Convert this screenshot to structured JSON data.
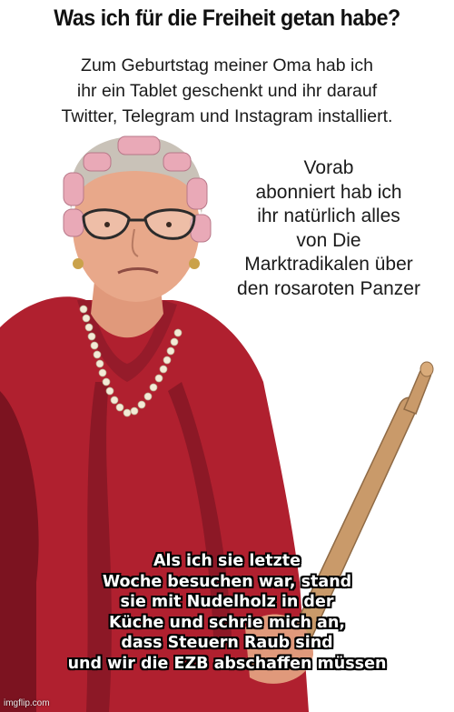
{
  "meme": {
    "title": "Was ich für die Freiheit getan habe?",
    "intro_lines": [
      "Zum Geburtstag meiner Oma hab ich",
      "ihr ein Tablet geschenkt und ihr darauf",
      "Twitter, Telegram und Instagram installiert."
    ],
    "side_lines": [
      "Vorab",
      "abonniert hab ich",
      "ihr natürlich alles",
      "von Die",
      "Marktradikalen über",
      "den rosaroten Panzer"
    ],
    "caption_lines": [
      "Als ich sie letzte",
      "Woche besuchen war, stand",
      "sie mit Nudelholz in der",
      "Küche und schrie mich an,",
      "dass Steuern Raub sind",
      "und wir die EZB abschaffen müssen"
    ],
    "watermark": "imgflip.com"
  },
  "colors": {
    "robe": "#b0202f",
    "robe_shadow": "#7c1320",
    "skin": "#e8a88a",
    "hair": "#c9c2b8",
    "curler": "#e9a9b7",
    "pin": "#c99a6a"
  },
  "illustration": {
    "subject": "grandmother-in-hair-curlers-with-rolling-pin"
  }
}
